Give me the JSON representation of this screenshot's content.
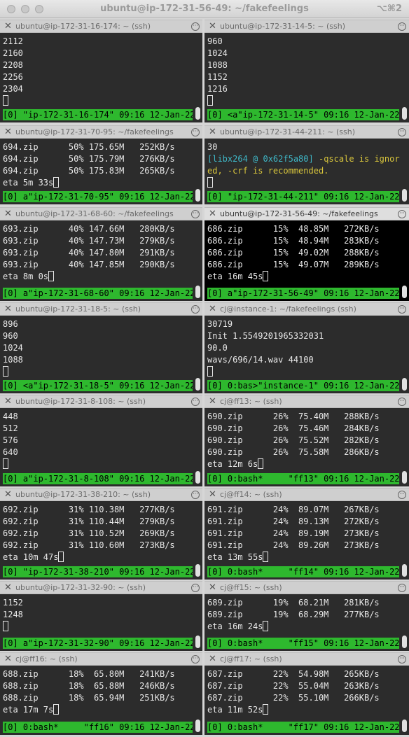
{
  "window": {
    "title": "ubuntu@ip-172-31-56-49: ~/fakefeelings",
    "shortcut": "⌥⌘2"
  },
  "panes": [
    {
      "title": "ubuntu@ip-172-31-16-174: ~ (ssh)",
      "lines": [
        "2112",
        "2160",
        "2208",
        "2256",
        "2304"
      ],
      "status": "[0] \"ip-172-31-16-174\" 09:16 12-Jan-22"
    },
    {
      "title": "ubuntu@ip-172-31-14-5: ~ (ssh)",
      "lines": [
        "960",
        "1024",
        "1088",
        "1152",
        "1216"
      ],
      "status": "[0] <a\"ip-172-31-14-5\" 09:16 12-Jan-22"
    },
    {
      "title": "ubuntu@ip-172-31-70-95: ~/fakefeelings",
      "lines": [
        "694.zip      50% 175.65M   252KB/s",
        "694.zip      50% 175.79M   276KB/s",
        "694.zip      50% 175.83M   265KB/s",
        "eta 5m 33s"
      ],
      "status": "[0] a\"ip-172-31-70-95\" 09:16 12-Jan-22"
    },
    {
      "title": "ubuntu@ip-172-31-44-211: ~ (ssh)",
      "lines": [
        "30",
        "[libx264 @ 0x62f5a80] -qscale is ignor",
        "ed, -crf is recommended."
      ],
      "status": "[0] \"ip-172-31-44-211\" 09:16 12-Jan-22"
    },
    {
      "title": "ubuntu@ip-172-31-68-60: ~/fakefeelings",
      "lines": [
        "693.zip      40% 147.66M   280KB/s",
        "693.zip      40% 147.73M   279KB/s",
        "693.zip      40% 147.80M   291KB/s",
        "693.zip      40% 147.85M   290KB/s",
        "eta 8m 0s"
      ],
      "status": "[0] a\"ip-172-31-68-60\" 09:16 12-Jan-22"
    },
    {
      "title": "ubuntu@ip-172-31-56-49: ~/fakefeelings",
      "lines": [
        "686.zip      15%  48.85M   272KB/s",
        "686.zip      15%  48.94M   283KB/s",
        "686.zip      15%  49.02M   288KB/s",
        "686.zip      15%  49.07M   289KB/s",
        "eta 16m 45s"
      ],
      "status": "[0] a\"ip-172-31-56-49\" 09:16 12-Jan-22"
    },
    {
      "title": "ubuntu@ip-172-31-18-5: ~ (ssh)",
      "lines": [
        "896",
        "960",
        "1024",
        "1088"
      ],
      "status": "[0] <a\"ip-172-31-18-5\" 09:16 12-Jan-22"
    },
    {
      "title": "cj@instance-1: ~/fakefeelings (ssh)",
      "lines": [
        "30719",
        "Init 1.5549201965332031",
        "90.0",
        "wavs/696/14.wav 44100"
      ],
      "status": "[0] 0:bas>\"instance-1\" 09:16 12-Jan-22"
    },
    {
      "title": "ubuntu@ip-172-31-8-108: ~ (ssh)",
      "lines": [
        "448",
        "512",
        "576",
        "640"
      ],
      "status": "[0] a\"ip-172-31-8-108\" 09:16 12-Jan-22"
    },
    {
      "title": "cj@ff13: ~ (ssh)",
      "lines": [
        "690.zip      26%  75.40M   288KB/s",
        "690.zip      26%  75.46M   284KB/s",
        "690.zip      26%  75.52M   282KB/s",
        "690.zip      26%  75.58M   286KB/s",
        "eta 12m 6s"
      ],
      "status": "[0] 0:bash*     \"ff13\" 09:16 12-Jan-22"
    },
    {
      "title": "ubuntu@ip-172-31-38-210: ~ (ssh)",
      "lines": [
        "692.zip      31% 110.38M   277KB/s",
        "692.zip      31% 110.44M   279KB/s",
        "692.zip      31% 110.52M   269KB/s",
        "692.zip      31% 110.60M   273KB/s",
        "eta 10m 47s"
      ],
      "status": "[0] \"ip-172-31-38-210\" 09:16 12-Jan-22"
    },
    {
      "title": "cj@ff14: ~ (ssh)",
      "lines": [
        "691.zip      24%  89.07M   267KB/s",
        "691.zip      24%  89.13M   272KB/s",
        "691.zip      24%  89.19M   273KB/s",
        "691.zip      24%  89.26M   273KB/s",
        "eta 13m 55s"
      ],
      "status": "[0] 0:bash*     \"ff14\" 09:16 12-Jan-22"
    },
    {
      "title": "ubuntu@ip-172-31-32-90: ~ (ssh)",
      "lines": [
        "1152",
        "1248"
      ],
      "status": "[0] a\"ip-172-31-32-90\" 09:16 12-Jan-22"
    },
    {
      "title": "cj@ff15: ~ (ssh)",
      "lines": [
        "689.zip      19%  68.21M   281KB/s",
        "689.zip      19%  68.29M   277KB/s",
        "eta 16m 24s"
      ],
      "status": "[0] 0:bash*     \"ff15\" 09:16 12-Jan-22"
    },
    {
      "title": "cj@ff16: ~ (ssh)",
      "lines": [
        "688.zip      18%  65.80M   241KB/s",
        "688.zip      18%  65.88M   246KB/s",
        "688.zip      18%  65.94M   251KB/s",
        "eta 17m 7s"
      ],
      "status": "[0] 0:bash*     \"ff16\" 09:16 12-Jan-22"
    },
    {
      "title": "cj@ff17: ~ (ssh)",
      "lines": [
        "687.zip      22%  54.98M   265KB/s",
        "687.zip      22%  55.04M   263KB/s",
        "687.zip      22%  55.10M   266KB/s",
        "eta 11m 52s"
      ],
      "status": "[0] 0:bash*     \"ff17\" 09:16 12-Jan-22"
    }
  ],
  "colors": {
    "status_bar": "#2eb82e",
    "pane_bg": "#2c2c2c",
    "active_pane_bg": "#000000",
    "libx_cyan": "#3fb7c7",
    "libx_yellow": "#d8c53c"
  }
}
